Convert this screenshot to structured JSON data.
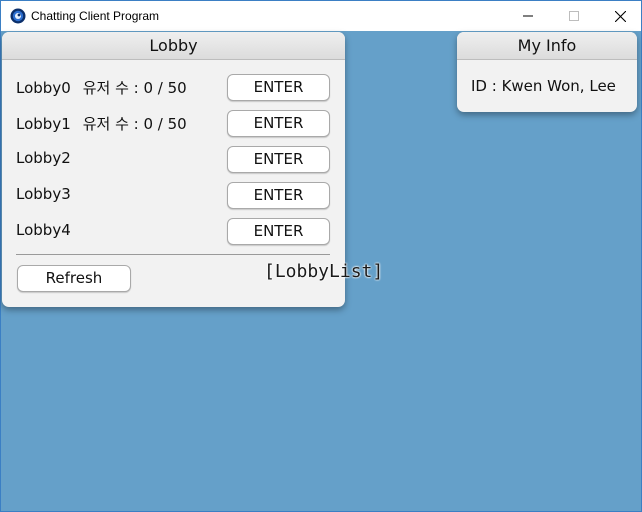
{
  "window": {
    "title": "Chatting Client Program",
    "icon": "app-icon",
    "controls": {
      "minimize_icon": "minimize-icon",
      "maximize_icon": "maximize-icon",
      "close_icon": "close-icon"
    },
    "background_color": "#65a0c9"
  },
  "lobby_panel": {
    "title": "Lobby",
    "rows": [
      {
        "name": "Lobby0",
        "user_count": "유저 수 : 0 / 50",
        "button": "ENTER"
      },
      {
        "name": "Lobby1",
        "user_count": "유저 수 : 0 / 50",
        "button": "ENTER"
      },
      {
        "name": "Lobby2",
        "user_count": "",
        "button": "ENTER"
      },
      {
        "name": "Lobby3",
        "user_count": "",
        "button": "ENTER"
      },
      {
        "name": "Lobby4",
        "user_count": "",
        "button": "ENTER"
      }
    ],
    "refresh_button": "Refresh"
  },
  "info_panel": {
    "title": "My Info",
    "id_text": "ID : Kwen Won, Lee"
  },
  "overlay_label": "[LobbyList]"
}
